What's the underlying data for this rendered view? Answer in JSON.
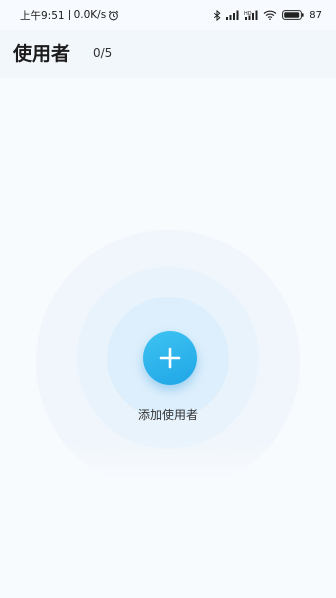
{
  "status_bar": {
    "time": "上午9:51",
    "speed": "0.0K/s",
    "signal_label": "HD",
    "battery": "87"
  },
  "header": {
    "title": "使用者",
    "count": "0/5"
  },
  "main": {
    "add_label": "添加使用者"
  },
  "colors": {
    "accent": "#28b0ec",
    "background": "#f8fbfe"
  }
}
